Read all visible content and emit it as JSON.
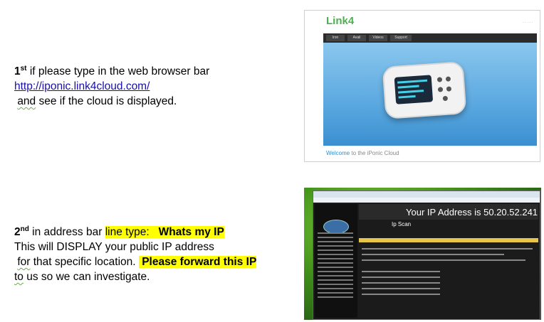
{
  "step1": {
    "ordinal_num": "1",
    "ordinal_sup": "st",
    "line1_rest": " if please type in the web browser bar",
    "url": "http://iponic.link4cloud.com/",
    "line3_a": "and",
    "line3_b": " see if the cloud is displayed."
  },
  "step2": {
    "ordinal_num": "2",
    "ordinal_sup": "nd",
    "line1_mid": " in address bar ",
    "line1_hl": "line type: ",
    "line1_hl_bold": "Whats my IP",
    "line2": "This will DISPLAY your public IP address",
    "line3_a": "for",
    "line3_b": " that specific location. ",
    "line3_hl": "Please forward this IP",
    "line4_a": "to",
    "line4_b": " us so we can investigate."
  },
  "screenshot1": {
    "logo": "Link",
    "logo_num": "4",
    "tabs": [
      "Iron",
      "Avail",
      "Videos",
      "Support"
    ],
    "welcome": "Welcome",
    "welcome_rest": " to the iPonic Cloud"
  },
  "screenshot2": {
    "title": "Your IP Address is 50.20.52.241",
    "scan_label": "Ip Scan"
  }
}
